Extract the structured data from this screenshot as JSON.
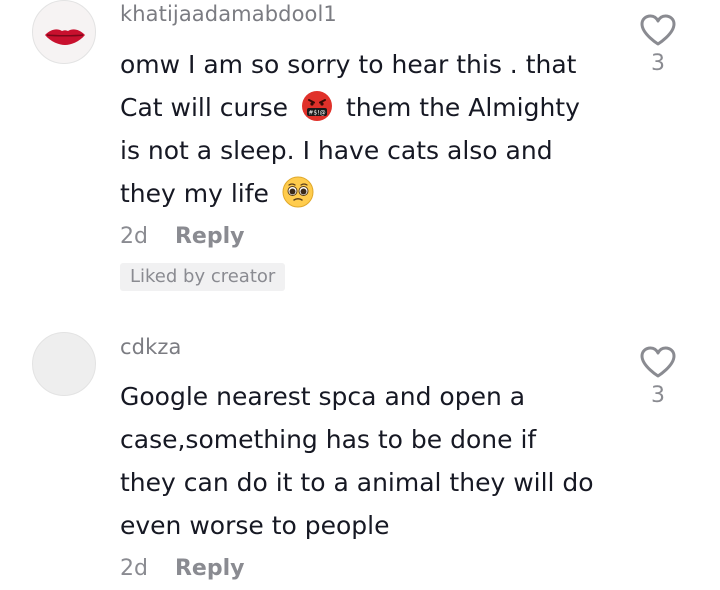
{
  "comments": [
    {
      "username": "khatijaadamabdool1",
      "avatar_icon": "lips-avatar",
      "text_lines": [
        "omw I am so sorry to hear this . that",
        [
          "Cat will curse",
          "them the Almighty"
        ],
        "is not a sleep. I have cats also and",
        "they my life"
      ],
      "emojis": [
        "cursing-face-emoji",
        "pleading-face-emoji"
      ],
      "time": "2d",
      "reply_label": "Reply",
      "badge": "Liked by creator",
      "like_icon": "heart-icon",
      "like_count": "3"
    },
    {
      "username": "cdkza",
      "avatar_icon": "default-avatar",
      "text_lines": [
        "Google nearest spca and open a",
        "case,something has to be done if",
        "they can do it to a animal they will do",
        "even worse to people"
      ],
      "time": "2d",
      "reply_label": "Reply",
      "like_icon": "heart-icon",
      "like_count": "3"
    }
  ],
  "colors": {
    "text": "#161823",
    "secondary": "#8a8b91",
    "badge_bg": "#f1f1f2"
  }
}
